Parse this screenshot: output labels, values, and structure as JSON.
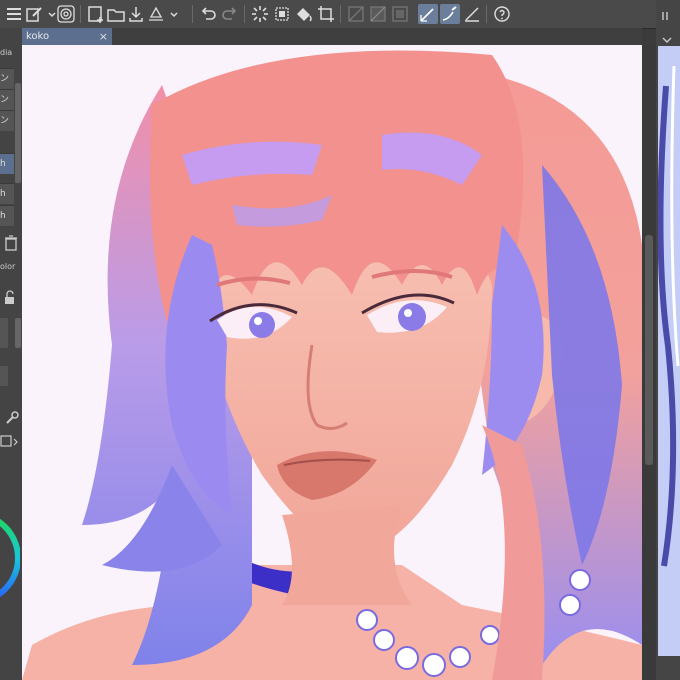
{
  "toolbar": {
    "icons": [
      "menu-icon",
      "new-file-icon",
      "chevron-down-icon",
      "spiral-icon",
      "new-canvas-icon",
      "open-folder-icon",
      "save-icon",
      "export-icon",
      "undo-icon",
      "redo-icon",
      "loading-icon",
      "transform-icon",
      "fill-icon",
      "crop-icon",
      "grid-off-icon",
      "ruler-off-icon",
      "layer-off-icon",
      "pen-pressure-icon",
      "stabilizer-icon",
      "vector-icon",
      "help-icon"
    ]
  },
  "tab": {
    "title": "koko",
    "close": "×"
  },
  "left_panel": {
    "header": "dia",
    "items": [
      "ン",
      "ン",
      "ン",
      "h",
      "h",
      "h"
    ],
    "color_label": "olor"
  },
  "colors": {
    "toolbar_bg": "#4a4a4a",
    "tab_active": "#5c6f8e",
    "canvas_bg": "#fbf3fb",
    "hair_pink": "#f79b9b",
    "hair_violet": "#8d86ec",
    "skin": "#f3b3a8",
    "lips": "#d97a70",
    "pearls": "#ffffff"
  }
}
